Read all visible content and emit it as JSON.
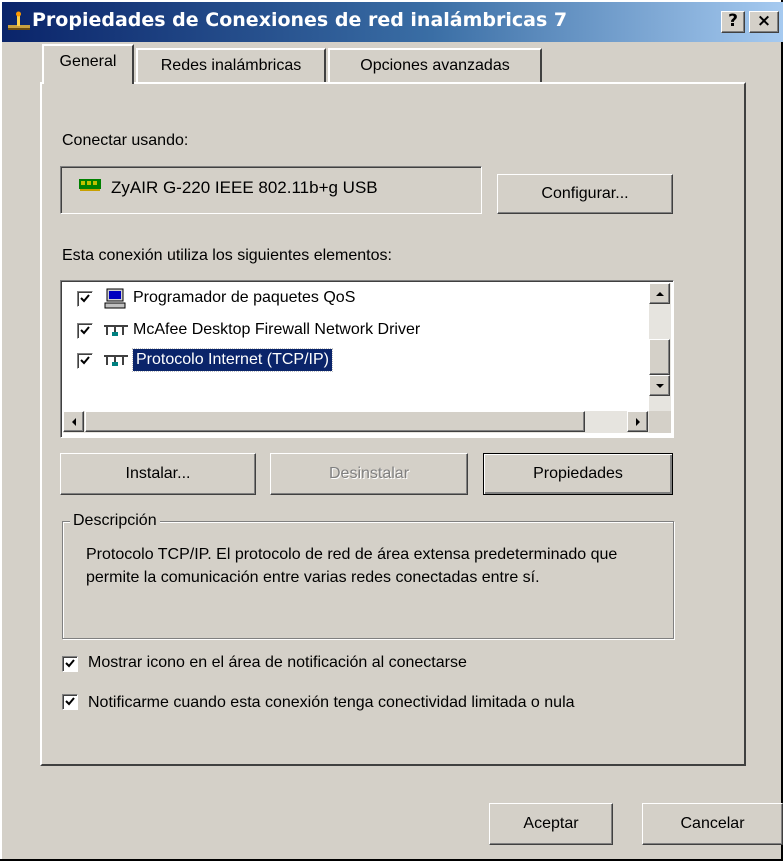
{
  "window": {
    "title": "Propiedades de Conexiones de red inalámbricas 7",
    "help_button": "?",
    "close_button": "×"
  },
  "tabs": [
    {
      "label": "General",
      "active": true
    },
    {
      "label": "Redes inalámbricas",
      "active": false
    },
    {
      "label": "Opciones avanzadas",
      "active": false
    }
  ],
  "general": {
    "connect_using_label": "Conectar usando:",
    "adapter_name": "ZyAIR G-220 IEEE 802.11b+g USB",
    "configure_button": "Configurar...",
    "components_label": "Esta conexión utiliza los siguientes elementos:",
    "components": [
      {
        "label": "Programador de paquetes QoS",
        "checked": true,
        "selected": false,
        "icon": "qos-scheduler-icon"
      },
      {
        "label": "McAfee Desktop Firewall Network Driver",
        "checked": true,
        "selected": false,
        "icon": "network-protocol-icon"
      },
      {
        "label": "Protocolo Internet (TCP/IP)",
        "checked": true,
        "selected": true,
        "icon": "network-protocol-icon"
      }
    ],
    "install_button": "Instalar...",
    "uninstall_button": "Desinstalar",
    "properties_button": "Propiedades",
    "description_title": "Descripción",
    "description_text": "Protocolo TCP/IP. El protocolo de red de área extensa predeterminado que permite la comunicación entre varias redes conectadas entre sí.",
    "show_icon_checkbox": {
      "label": "Mostrar icono en el área de notificación al conectarse",
      "checked": true
    },
    "notify_checkbox": {
      "label": "Notificarme cuando esta conexión tenga conectividad limitada o nula",
      "checked": true
    }
  },
  "footer": {
    "ok_button": "Aceptar",
    "cancel_button": "Cancelar"
  },
  "colors": {
    "title_gradient_start": "#0a246a",
    "title_gradient_end": "#a6caf0",
    "dialog_face": "#d4d0c8",
    "selection": "#0a246a"
  }
}
